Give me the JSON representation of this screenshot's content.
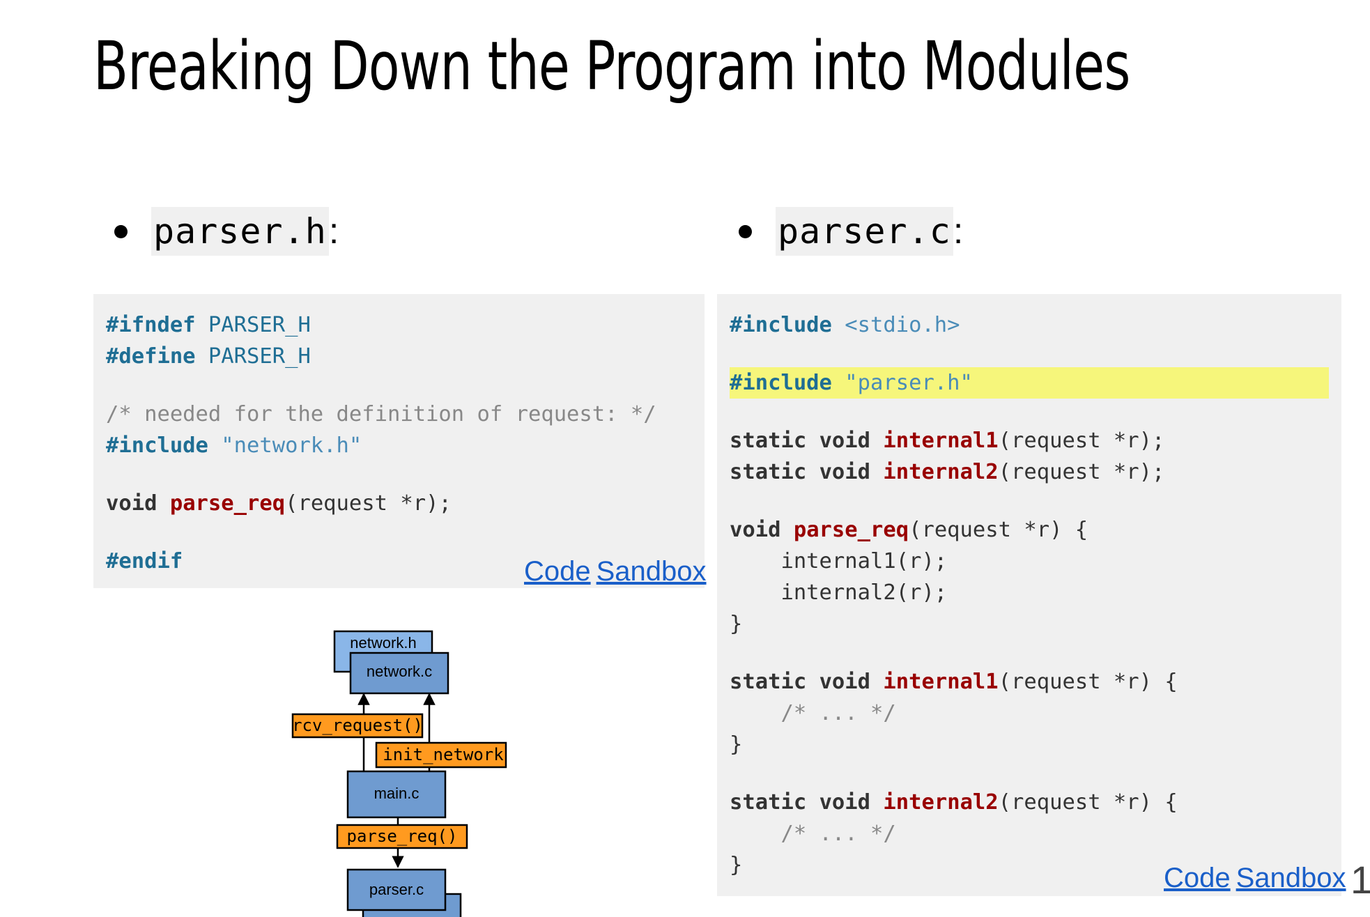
{
  "slide": {
    "title": "Breaking Down the Program into Modules",
    "page_number": "1"
  },
  "left": {
    "bullet_file": "parser.h",
    "bullet_colon": ":",
    "code": [
      [
        {
          "t": "#ifndef",
          "c": "kw-pre"
        },
        {
          "t": " PARSER_H",
          "c": "kw-pl"
        }
      ],
      [
        {
          "t": "#define",
          "c": "kw-pre"
        },
        {
          "t": " PARSER_H",
          "c": "kw-pl"
        }
      ],
      "gap",
      [
        {
          "t": "/* needed for the definition of request: */",
          "c": "kw-cm"
        }
      ],
      [
        {
          "t": "#include",
          "c": "kw-pre"
        },
        {
          "t": " \"network.h\"",
          "c": "kw-str"
        }
      ],
      "gap",
      [
        {
          "t": "void",
          "c": "kw-ty"
        },
        {
          "t": " ",
          "c": ""
        },
        {
          "t": "parse_req",
          "c": "kw-fn"
        },
        {
          "t": "(request *r);",
          "c": ""
        }
      ],
      "gap",
      [
        {
          "t": "#endif",
          "c": "kw-pre"
        }
      ]
    ],
    "link_code": "Code",
    "link_sandbox": "Sandbox"
  },
  "right": {
    "bullet_file": "parser.c",
    "bullet_colon": ":",
    "code": [
      [
        {
          "t": "#include",
          "c": "kw-pre"
        },
        {
          "t": " <stdio.h>",
          "c": "kw-str"
        }
      ],
      "gap",
      {
        "hl": true,
        "parts": [
          {
            "t": "#include",
            "c": "kw-pre"
          },
          {
            "t": " \"parser.h\"",
            "c": "kw-str"
          }
        ]
      },
      "gap",
      [
        {
          "t": "static",
          "c": "kw-ty"
        },
        {
          "t": " ",
          "c": ""
        },
        {
          "t": "void",
          "c": "kw-ty"
        },
        {
          "t": " ",
          "c": ""
        },
        {
          "t": "internal1",
          "c": "kw-fn"
        },
        {
          "t": "(request *r);",
          "c": ""
        }
      ],
      [
        {
          "t": "static",
          "c": "kw-ty"
        },
        {
          "t": " ",
          "c": ""
        },
        {
          "t": "void",
          "c": "kw-ty"
        },
        {
          "t": " ",
          "c": ""
        },
        {
          "t": "internal2",
          "c": "kw-fn"
        },
        {
          "t": "(request *r);",
          "c": ""
        }
      ],
      "gap",
      [
        {
          "t": "void",
          "c": "kw-ty"
        },
        {
          "t": " ",
          "c": ""
        },
        {
          "t": "parse_req",
          "c": "kw-fn"
        },
        {
          "t": "(request *r) {",
          "c": ""
        }
      ],
      [
        {
          "t": "    internal1(r);",
          "c": ""
        }
      ],
      [
        {
          "t": "    internal2(r);",
          "c": ""
        }
      ],
      [
        {
          "t": "}",
          "c": ""
        }
      ],
      "gap",
      [
        {
          "t": "static",
          "c": "kw-ty"
        },
        {
          "t": " ",
          "c": ""
        },
        {
          "t": "void",
          "c": "kw-ty"
        },
        {
          "t": " ",
          "c": ""
        },
        {
          "t": "internal1",
          "c": "kw-fn"
        },
        {
          "t": "(request *r) {",
          "c": ""
        }
      ],
      [
        {
          "t": "    /* ... */",
          "c": "kw-cm"
        }
      ],
      [
        {
          "t": "}",
          "c": ""
        }
      ],
      "gap",
      [
        {
          "t": "static",
          "c": "kw-ty"
        },
        {
          "t": " ",
          "c": ""
        },
        {
          "t": "void",
          "c": "kw-ty"
        },
        {
          "t": " ",
          "c": ""
        },
        {
          "t": "internal2",
          "c": "kw-fn"
        },
        {
          "t": "(request *r) {",
          "c": ""
        }
      ],
      [
        {
          "t": "    /* ... */",
          "c": "kw-cm"
        }
      ],
      [
        {
          "t": "}",
          "c": ""
        }
      ]
    ],
    "link_code": "Code",
    "link_sandbox": "Sandbox"
  },
  "diagram": {
    "network_h": "network.h",
    "network_c": "network.c",
    "rcv_request": "rcv_request()",
    "init_network": "init_network",
    "main_c": "main.c",
    "parse_req": "parse_req()",
    "parser_c": "parser.c",
    "colors": {
      "module_light": "#8ab6e8",
      "module": "#6f9bd0",
      "function": "#ff9a1f"
    }
  }
}
